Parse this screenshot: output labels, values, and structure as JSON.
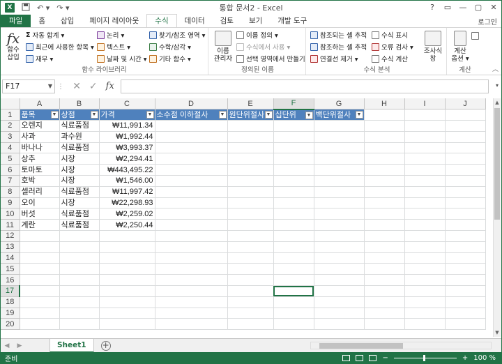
{
  "app": {
    "title": "통합 문서2 - Excel",
    "logo": "X",
    "login": "로그인"
  },
  "qat": {
    "save_icon": "save-icon",
    "undo_icon": "undo-icon",
    "redo_icon": "redo-icon"
  },
  "window_controls": [
    "?",
    "▭",
    "—",
    "▢",
    "✕"
  ],
  "tabs": [
    "파일",
    "홈",
    "삽입",
    "페이지 레이아웃",
    "수식",
    "데이터",
    "검토",
    "보기",
    "개발 도구"
  ],
  "ribbon": {
    "insert_function": {
      "icon": "fx",
      "label1": "함수",
      "label2": "삽입"
    },
    "library": {
      "autosum": "자동 합계 ▾",
      "recent": "최근에 사용한 항목 ▾",
      "finance": "재무 ▾",
      "logical": "논리 ▾",
      "text": "텍스트 ▾",
      "datetime": "날짜 및 시간 ▾",
      "lookup": "찾기/참조 영역 ▾",
      "math": "수학/삼각 ▾",
      "more": "기타 함수 ▾",
      "group_label": "함수 라이브러리"
    },
    "names": {
      "manager1": "이름",
      "manager2": "관리자",
      "define": "이름 정의 ▾",
      "use": "수식에서 사용 ▾",
      "create": "선택 영역에서 만들기",
      "group_label": "정의된 이름"
    },
    "audit": {
      "precedents": "참조되는 셀 추적",
      "dependents": "참조하는 셀 추적",
      "remove": "연결선 제거 ▾",
      "show": "수식 표시",
      "error": "오류 검사 ▾",
      "evaluate": "수식 계산",
      "watch1": "조사식",
      "watch2": "창",
      "group_label": "수식 분석"
    },
    "calc": {
      "options1": "계산",
      "options2": "옵션 ▾",
      "group_label": "계산"
    }
  },
  "formula_bar": {
    "name_box": "F17",
    "cancel": "✕",
    "enter": "✓",
    "fx": "fx",
    "content": ""
  },
  "columns": [
    "A",
    "B",
    "C",
    "D",
    "E",
    "F",
    "G",
    "H",
    "I",
    "J"
  ],
  "selected_col": "F",
  "selected_row": 17,
  "row_count": 20,
  "table": {
    "headers": [
      "품목",
      "상점",
      "가격",
      "소수점 이하절사",
      "원단위절사",
      "십단위",
      "백단위절사"
    ],
    "rows": [
      [
        "오렌지",
        "식료품점",
        "₩11,991.34"
      ],
      [
        "사과",
        "과수원",
        "₩1,992.44"
      ],
      [
        "바나나",
        "식료품점",
        "₩3,993.37"
      ],
      [
        "상추",
        "시장",
        "₩2,294.41"
      ],
      [
        "토마토",
        "시장",
        "₩443,495.22"
      ],
      [
        "호박",
        "시장",
        "₩1,546.00"
      ],
      [
        "셀러리",
        "식료품점",
        "₩11,997.42"
      ],
      [
        "오이",
        "시장",
        "₩22,298.93"
      ],
      [
        "버섯",
        "식료품점",
        "₩2,259.02"
      ],
      [
        "계란",
        "식료품점",
        "₩2,250.44"
      ]
    ]
  },
  "sheet_tabs": [
    "Sheet1"
  ],
  "status": {
    "ready": "준비",
    "zoom": "100 %",
    "minus": "−",
    "plus": "+"
  }
}
